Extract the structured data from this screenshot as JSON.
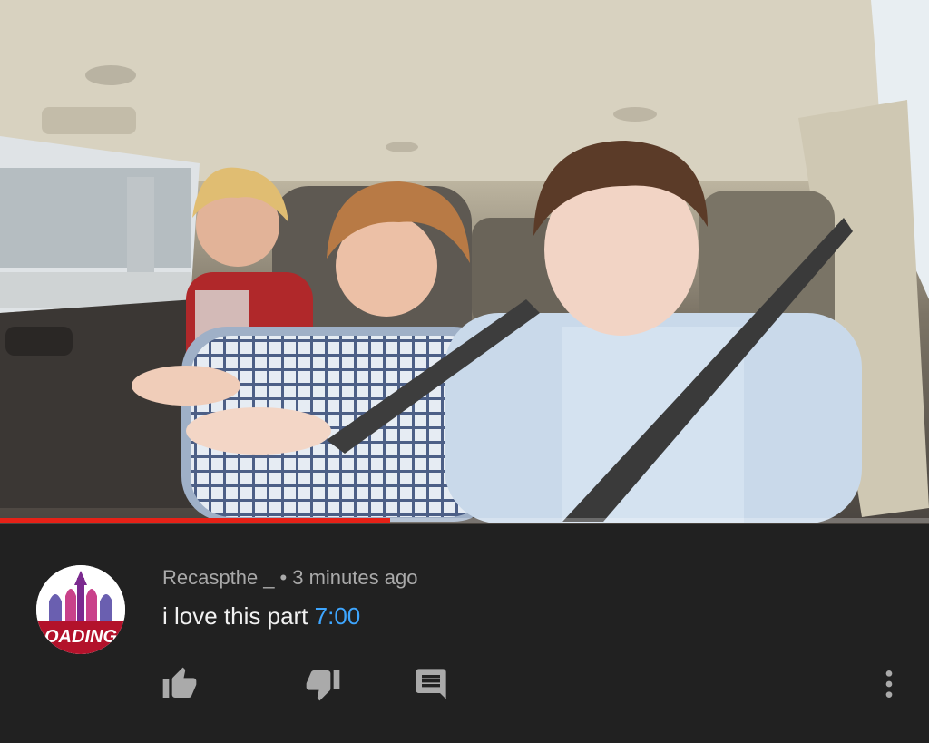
{
  "video": {
    "progress_percent": 42,
    "progress_color": "#e62117",
    "scene": "photo-car-interior"
  },
  "comment": {
    "author": "Recaspthe _",
    "separator": "•",
    "time_ago": "3 minutes ago",
    "text": "i love this part",
    "timestamp_link": "7:00",
    "avatar_text": "OADING",
    "actions": {
      "like_icon": "thumbs-up-icon",
      "dislike_icon": "thumbs-down-icon",
      "reply_icon": "reply-icon",
      "more_icon": "more-vert-icon"
    }
  },
  "colors": {
    "background": "#212121",
    "meta_text": "#aaaaaa",
    "comment_text": "#f1f1f1",
    "link": "#3ea6ff",
    "icon": "#aaaaaa"
  }
}
